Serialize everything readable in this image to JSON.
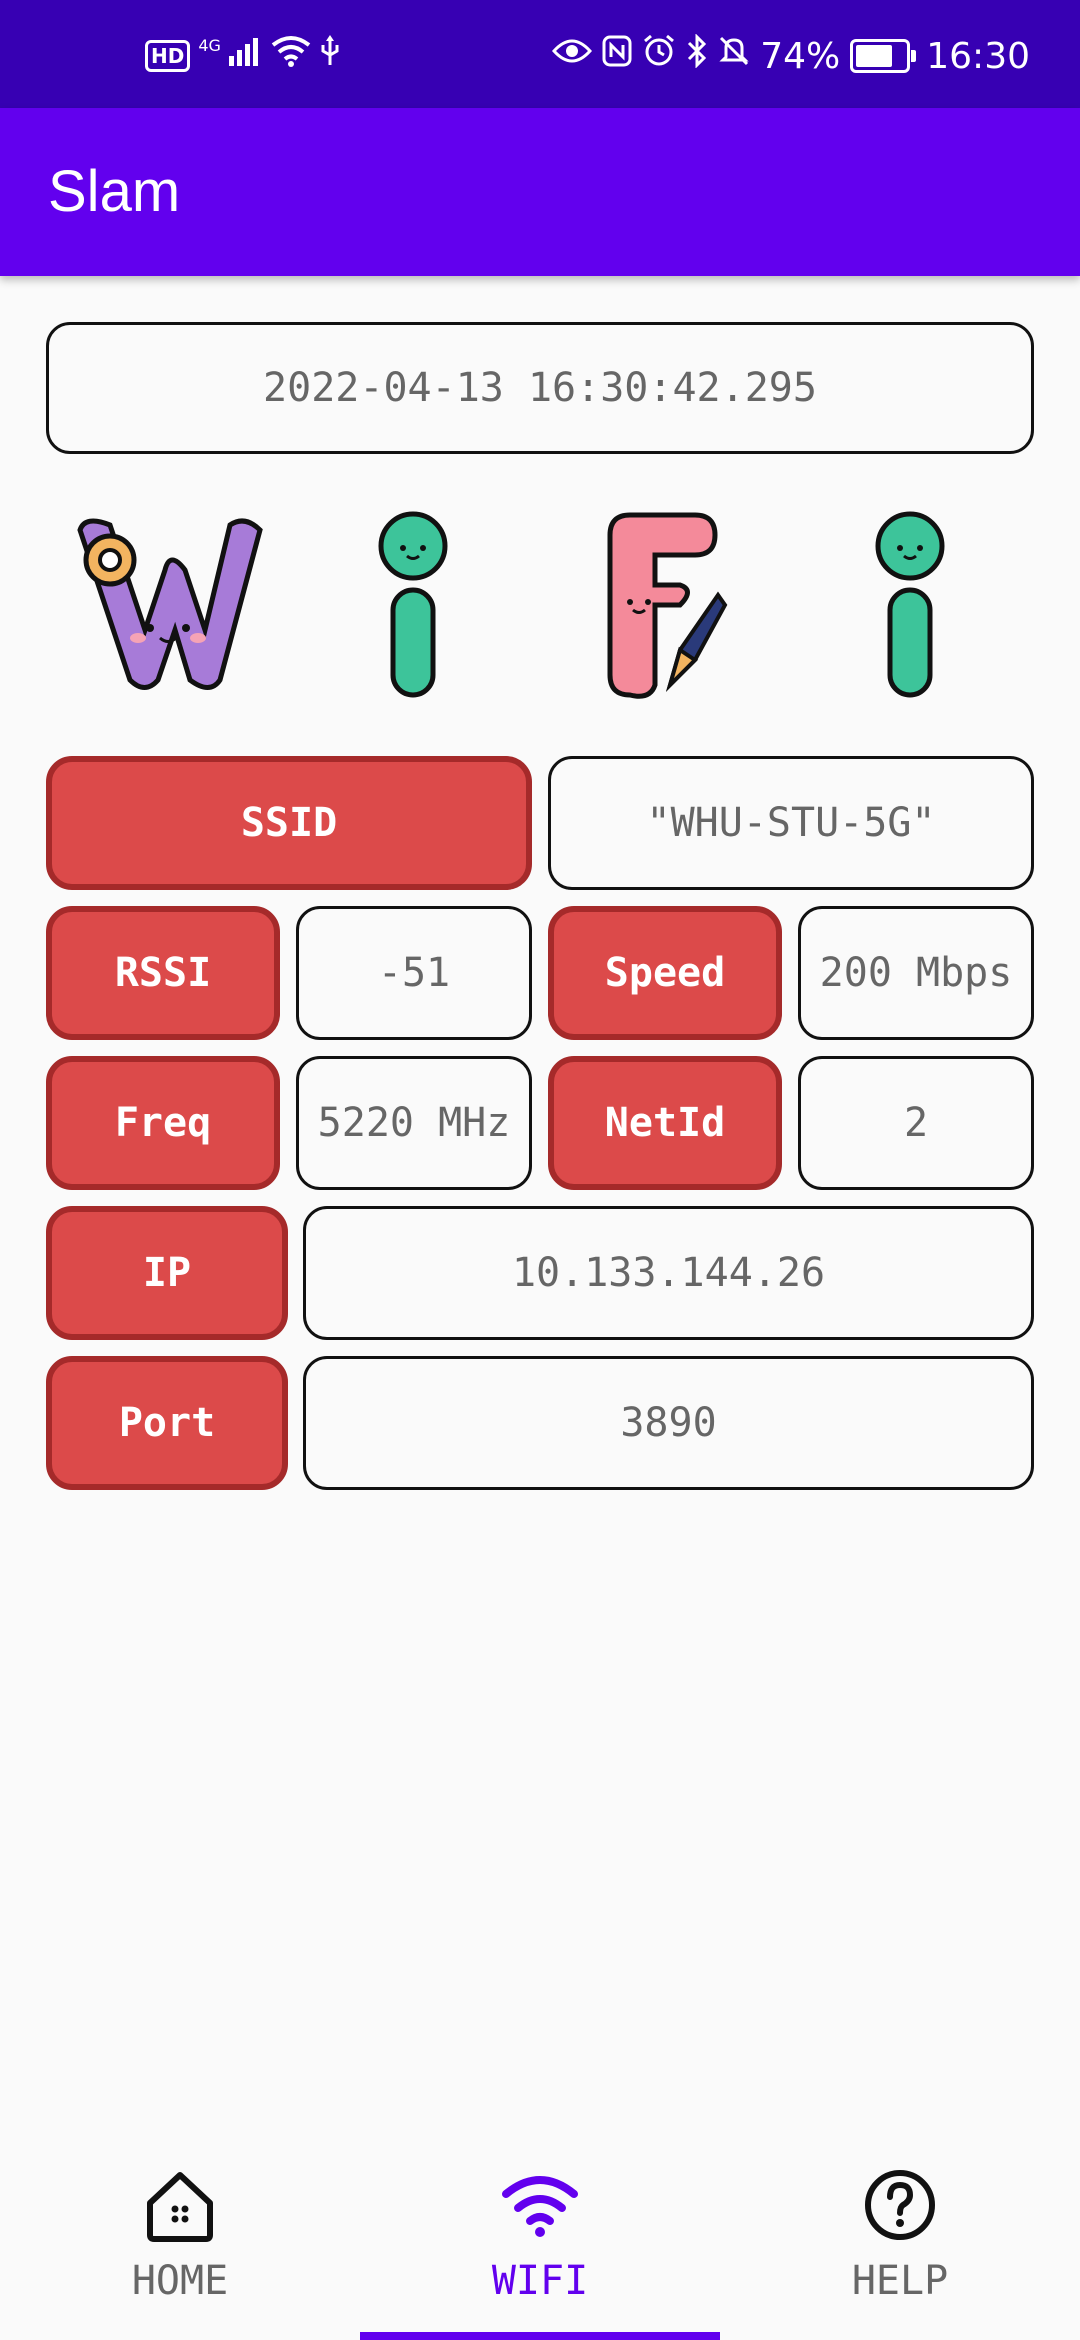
{
  "status_bar": {
    "hd": "HD",
    "network": "4G",
    "battery_percent": "74%",
    "battery_level": 0.74,
    "time": "16:30"
  },
  "app_bar": {
    "title": "Slam"
  },
  "timestamp": "2022-04-13 16:30:42.295",
  "wifi_letters": [
    "W",
    "i",
    "F",
    "i"
  ],
  "fields": {
    "ssid": {
      "label": "SSID",
      "value": "\"WHU-STU-5G\""
    },
    "rssi": {
      "label": "RSSI",
      "value": "-51"
    },
    "speed": {
      "label": "Speed",
      "value": "200 Mbps"
    },
    "freq": {
      "label": "Freq",
      "value": "5220 MHz"
    },
    "netid": {
      "label": "NetId",
      "value": "2"
    },
    "ip": {
      "label": "IP",
      "value": "10.133.144.26"
    },
    "port": {
      "label": "Port",
      "value": "3890"
    }
  },
  "bottom_nav": {
    "items": [
      {
        "label": "HOME",
        "icon": "home-icon"
      },
      {
        "label": "WIFI",
        "icon": "wifi-icon"
      },
      {
        "label": "HELP",
        "icon": "help-icon"
      }
    ],
    "active": "WIFI"
  },
  "colors": {
    "primary": "#6200ee",
    "status_bar": "#3700b3",
    "label_fill": "#dc4a4a",
    "label_border": "#a52a2a"
  }
}
